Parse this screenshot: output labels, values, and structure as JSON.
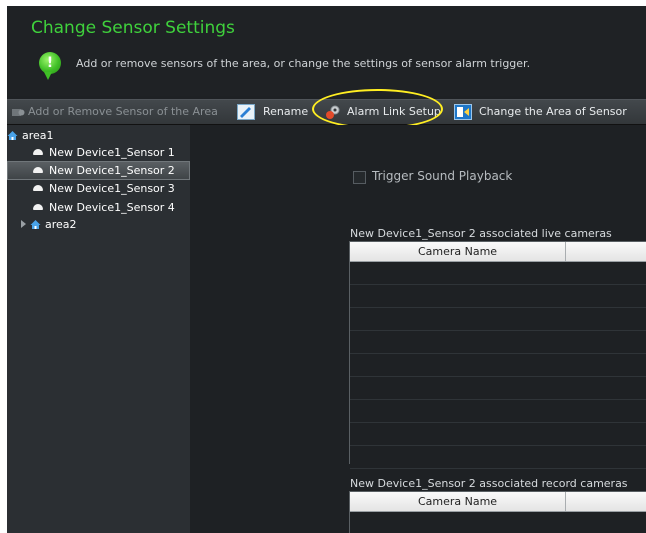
{
  "header": {
    "title": "Change Sensor Settings",
    "subtitle": "Add or remove sensors of the area, or change the settings of sensor alarm trigger.",
    "info_icon": "info-bubble-icon"
  },
  "toolbar": {
    "add_remove_label": "Add or Remove Sensor of the Area",
    "rename_label": "Rename",
    "alarm_link_label": "Alarm Link Setup",
    "change_area_label": "Change the Area of Sensor",
    "highlight_color": "#ffee22"
  },
  "tree": {
    "root": "area1",
    "sensors": [
      "New Device1_Sensor 1",
      "New Device1_Sensor 2",
      "New Device1_Sensor 3",
      "New Device1_Sensor 4"
    ],
    "selected_index": 1,
    "area2": "area2"
  },
  "main": {
    "trigger_sound_label": "Trigger Sound Playback",
    "trigger_sound_checked": false,
    "live_cameras_label": "New Device1_Sensor 2 associated live cameras",
    "record_cameras_label": "New Device1_Sensor 2 associated record cameras",
    "camera_col_header": "Camera Name"
  },
  "colors": {
    "title_green": "#3fd13c",
    "background": "#1e2124",
    "tree_bg": "#2b2f33"
  }
}
